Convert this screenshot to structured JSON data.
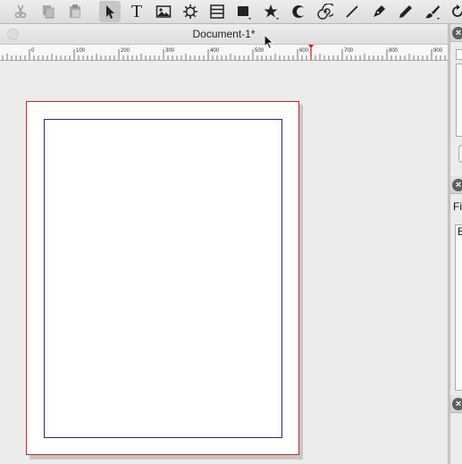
{
  "toolbar": {
    "tools": [
      {
        "name": "cut-icon",
        "active": false
      },
      {
        "name": "copy-icon",
        "active": false
      },
      {
        "name": "paste-icon",
        "active": false
      },
      {
        "name": "select-arrow-icon",
        "active": true
      },
      {
        "name": "text-tool-icon",
        "active": false
      },
      {
        "name": "image-tool-icon",
        "active": false
      },
      {
        "name": "gear-shape-icon",
        "active": false
      },
      {
        "name": "table-tool-icon",
        "active": false
      },
      {
        "name": "rectangle-tool-icon",
        "active": false
      },
      {
        "name": "star-tool-icon",
        "active": false
      },
      {
        "name": "arc-tool-icon",
        "active": false
      },
      {
        "name": "spiral-tool-icon",
        "active": false
      },
      {
        "name": "line-tool-icon",
        "active": false
      },
      {
        "name": "pen-tool-icon",
        "active": false
      },
      {
        "name": "pencil-tool-icon",
        "active": false
      },
      {
        "name": "brush-tool-icon",
        "active": false
      },
      {
        "name": "rotate-icon",
        "active": false
      }
    ],
    "text_tool_glyph": "T"
  },
  "document": {
    "title": "Document-1*"
  },
  "ruler": {
    "labels": [
      "0",
      "100",
      "200",
      "300",
      "400",
      "500",
      "600",
      "700",
      "800",
      "900"
    ],
    "marker_value": 630
  },
  "side_panels": {
    "close_glyph": "×",
    "panel2_text_1": "Fi",
    "panel2_text_2": "E"
  }
}
